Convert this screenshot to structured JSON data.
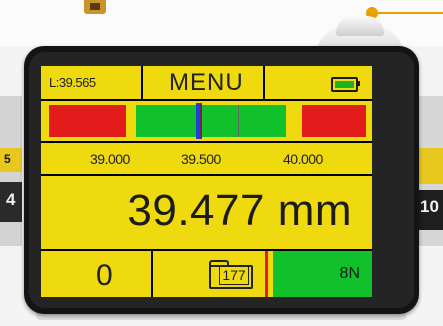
{
  "edge": {
    "left_top": "5",
    "left_bottom": "4",
    "right_bottom": "10"
  },
  "header": {
    "length_label": "L:39.565",
    "menu_label": "MENU",
    "battery_icon": "battery-full-icon"
  },
  "tolerance": {
    "scale": [
      "39.000",
      "39.500",
      "40.000"
    ]
  },
  "measurement": {
    "value": "39.477",
    "unit": "mm"
  },
  "footer": {
    "count": "0",
    "folder_icon": "folder-icon",
    "folder_number": "177",
    "force": "8N"
  },
  "colors": {
    "screen_yellow": "#efd90f",
    "zone_red": "#e21b1b",
    "zone_green": "#10c12c",
    "cursor_blue": "#1f3fdd",
    "battery_green": "#19b61c"
  }
}
